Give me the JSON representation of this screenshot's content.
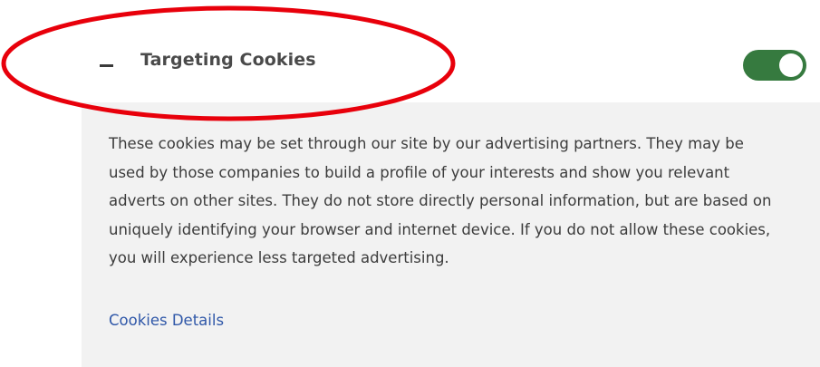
{
  "section": {
    "title": "Targeting Cookies",
    "description": "These cookies may be set through our site by our advertising partners. They may be used by those companies to build a profile of your interests and show you relevant adverts on other sites. They do not store directly personal information, but are based on uniquely identifying your browser and internet device. If you do not allow these cookies, you will experience less targeted advertising.",
    "details_link": "Cookies Details",
    "expanded": true,
    "toggle_on": true,
    "collapse_icon": "minus-icon"
  },
  "colors": {
    "toggle_on": "#367a3f",
    "panel_background": "#f2f2f2",
    "link": "#2f57a8",
    "annotation": "#e8000b"
  }
}
